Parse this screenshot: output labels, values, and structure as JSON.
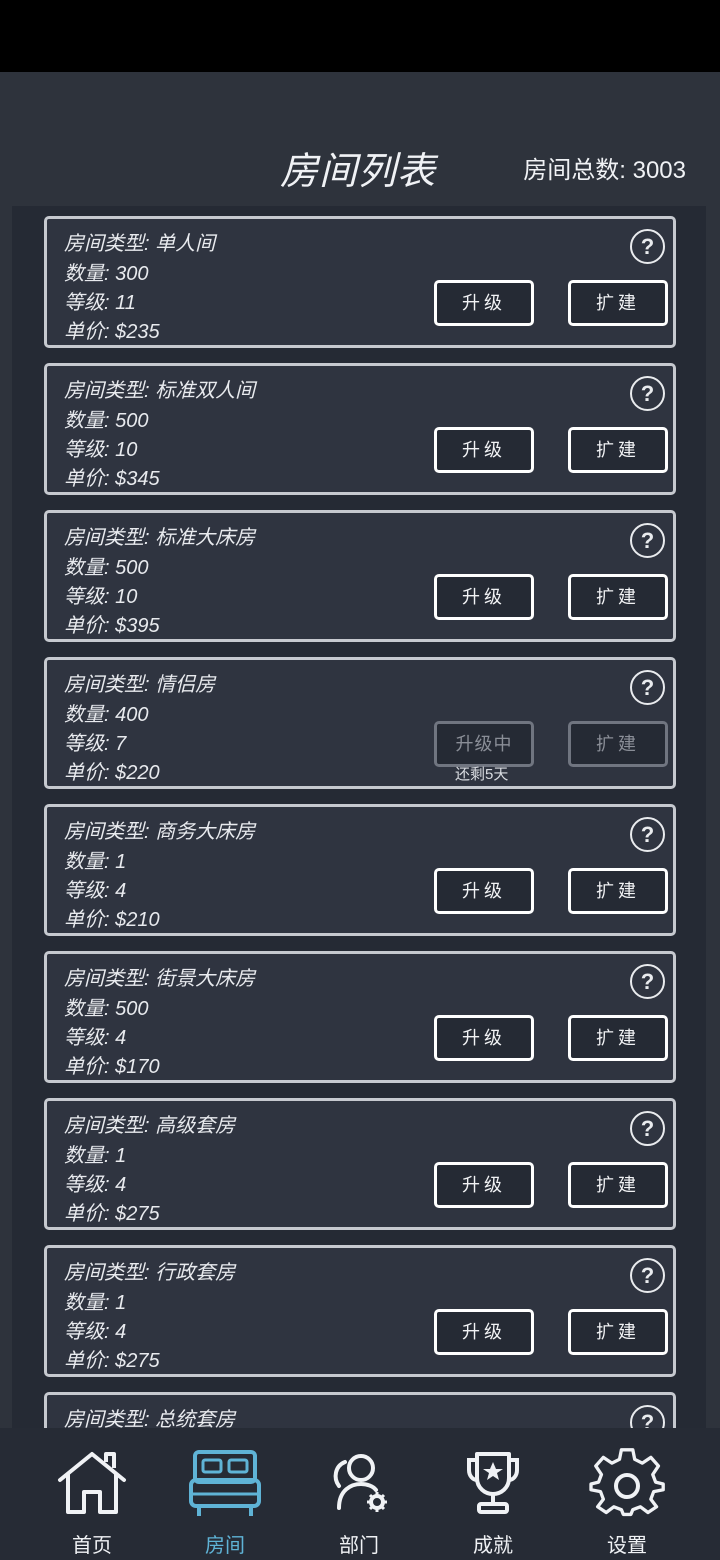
{
  "header": {
    "title": "房间列表",
    "total_label": "房间总数: 3003"
  },
  "rooms": [
    {
      "type": "房间类型: 单人间",
      "count": "数量: 300",
      "level": "等级: 11",
      "price": "单价: $235",
      "upgrade": "升级",
      "expand": "扩建"
    },
    {
      "type": "房间类型: 标准双人间",
      "count": "数量: 500",
      "level": "等级: 10",
      "price": "单价: $345",
      "upgrade": "升级",
      "expand": "扩建"
    },
    {
      "type": "房间类型: 标准大床房",
      "count": "数量: 500",
      "level": "等级: 10",
      "price": "单价: $395",
      "upgrade": "升级",
      "expand": "扩建"
    },
    {
      "type": "房间类型: 情侣房",
      "count": "数量: 400",
      "level": "等级: 7",
      "price": "单价: $220",
      "upgrade": "升级中",
      "expand": "扩建",
      "remaining": "还剩5天"
    },
    {
      "type": "房间类型: 商务大床房",
      "count": "数量: 1",
      "level": "等级: 4",
      "price": "单价: $210",
      "upgrade": "升级",
      "expand": "扩建"
    },
    {
      "type": "房间类型: 街景大床房",
      "count": "数量: 500",
      "level": "等级: 4",
      "price": "单价: $170",
      "upgrade": "升级",
      "expand": "扩建"
    },
    {
      "type": "房间类型: 高级套房",
      "count": "数量: 1",
      "level": "等级: 4",
      "price": "单价: $275",
      "upgrade": "升级",
      "expand": "扩建"
    },
    {
      "type": "房间类型: 行政套房",
      "count": "数量: 1",
      "level": "等级: 4",
      "price": "单价: $275",
      "upgrade": "升级",
      "expand": "扩建"
    },
    {
      "type": "房间类型: 总统套房"
    }
  ],
  "help_glyph": "?",
  "nav": {
    "items": [
      {
        "label": "首页",
        "icon": "home-icon"
      },
      {
        "label": "房间",
        "icon": "bed-icon",
        "active": true
      },
      {
        "label": "部门",
        "icon": "department-icon"
      },
      {
        "label": "成就",
        "icon": "trophy-icon"
      },
      {
        "label": "设置",
        "icon": "gear-icon"
      }
    ],
    "active_color": "#5fb3d6"
  }
}
